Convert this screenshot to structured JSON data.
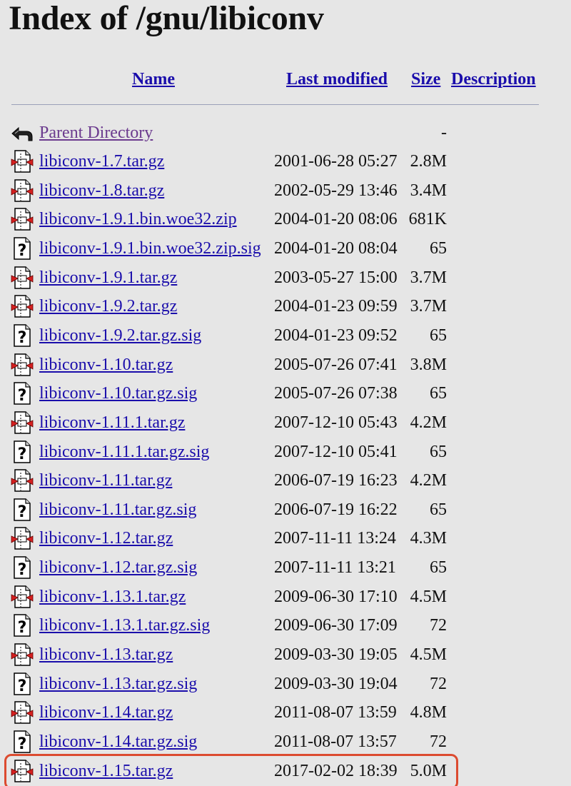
{
  "page": {
    "title": "Index of /gnu/libiconv"
  },
  "columns": {
    "name": "Name",
    "last_modified": "Last modified",
    "size": "Size",
    "description": "Description"
  },
  "parent": {
    "label": "Parent Directory",
    "size": "-",
    "icon": "back-icon"
  },
  "rows": [
    {
      "name": "libiconv-1.7.tar.gz",
      "date": "2001-06-28 05:27",
      "size": "2.8M",
      "icon": "archive-icon"
    },
    {
      "name": "libiconv-1.8.tar.gz",
      "date": "2002-05-29 13:46",
      "size": "3.4M",
      "icon": "archive-icon"
    },
    {
      "name": "libiconv-1.9.1.bin.woe32.zip",
      "date": "2004-01-20 08:06",
      "size": "681K",
      "icon": "archive-icon"
    },
    {
      "name": "libiconv-1.9.1.bin.woe32.zip.sig",
      "date": "2004-01-20 08:04",
      "size": "65",
      "icon": "unknown-icon"
    },
    {
      "name": "libiconv-1.9.1.tar.gz",
      "date": "2003-05-27 15:00",
      "size": "3.7M",
      "icon": "archive-icon"
    },
    {
      "name": "libiconv-1.9.2.tar.gz",
      "date": "2004-01-23 09:59",
      "size": "3.7M",
      "icon": "archive-icon"
    },
    {
      "name": "libiconv-1.9.2.tar.gz.sig",
      "date": "2004-01-23 09:52",
      "size": "65",
      "icon": "unknown-icon"
    },
    {
      "name": "libiconv-1.10.tar.gz",
      "date": "2005-07-26 07:41",
      "size": "3.8M",
      "icon": "archive-icon"
    },
    {
      "name": "libiconv-1.10.tar.gz.sig",
      "date": "2005-07-26 07:38",
      "size": "65",
      "icon": "unknown-icon"
    },
    {
      "name": "libiconv-1.11.1.tar.gz",
      "date": "2007-12-10 05:43",
      "size": "4.2M",
      "icon": "archive-icon"
    },
    {
      "name": "libiconv-1.11.1.tar.gz.sig",
      "date": "2007-12-10 05:41",
      "size": "65",
      "icon": "unknown-icon"
    },
    {
      "name": "libiconv-1.11.tar.gz",
      "date": "2006-07-19 16:23",
      "size": "4.2M",
      "icon": "archive-icon"
    },
    {
      "name": "libiconv-1.11.tar.gz.sig",
      "date": "2006-07-19 16:22",
      "size": "65",
      "icon": "unknown-icon"
    },
    {
      "name": "libiconv-1.12.tar.gz",
      "date": "2007-11-11 13:24",
      "size": "4.3M",
      "icon": "archive-icon"
    },
    {
      "name": "libiconv-1.12.tar.gz.sig",
      "date": "2007-11-11 13:21",
      "size": "65",
      "icon": "unknown-icon"
    },
    {
      "name": "libiconv-1.13.1.tar.gz",
      "date": "2009-06-30 17:10",
      "size": "4.5M",
      "icon": "archive-icon"
    },
    {
      "name": "libiconv-1.13.1.tar.gz.sig",
      "date": "2009-06-30 17:09",
      "size": "72",
      "icon": "unknown-icon"
    },
    {
      "name": "libiconv-1.13.tar.gz",
      "date": "2009-03-30 19:05",
      "size": "4.5M",
      "icon": "archive-icon"
    },
    {
      "name": "libiconv-1.13.tar.gz.sig",
      "date": "2009-03-30 19:04",
      "size": "72",
      "icon": "unknown-icon"
    },
    {
      "name": "libiconv-1.14.tar.gz",
      "date": "2011-08-07 13:59",
      "size": "4.8M",
      "icon": "archive-icon"
    },
    {
      "name": "libiconv-1.14.tar.gz.sig",
      "date": "2011-08-07 13:57",
      "size": "72",
      "icon": "unknown-icon"
    },
    {
      "name": "libiconv-1.15.tar.gz",
      "date": "2017-02-02 18:39",
      "size": "5.0M",
      "icon": "archive-icon"
    }
  ],
  "colors": {
    "link": "#1a0dab",
    "visited_link": "#6b3a8e",
    "highlight_border": "#dc4b30",
    "background": "#e6e6e6"
  }
}
